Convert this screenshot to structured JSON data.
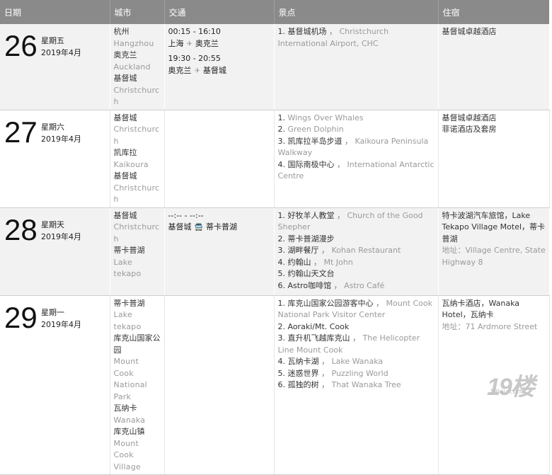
{
  "headers": {
    "date": "日期",
    "city": "城市",
    "transport": "交通",
    "sights": "景点",
    "hotel": "住宿"
  },
  "rows": [
    {
      "day": "26",
      "weekday": "星期五",
      "month": "2019年4月",
      "cities": [
        {
          "cn": "杭州",
          "en": "Hangzhou"
        },
        {
          "cn": "奥克兰",
          "en": "Auckland"
        },
        {
          "cn": "基督城",
          "en": "Christchurch"
        }
      ],
      "transport": [
        {
          "time": "00:15 - 16:10",
          "from": "上海",
          "to": "奥克兰",
          "mode": "✈"
        },
        {
          "time": "19:30 - 20:55",
          "from": "奥克兰",
          "to": "基督城",
          "mode": "✈"
        }
      ],
      "sights": [
        {
          "cn": "1. 基督城机场",
          "en": "Christchurch International Airport, CHC"
        }
      ],
      "hotel": {
        "lines": [
          "基督城卓越酒店"
        ],
        "addr": ""
      }
    },
    {
      "day": "27",
      "weekday": "星期六",
      "month": "2019年4月",
      "cities": [
        {
          "cn": "基督城",
          "en": "Christchurch"
        },
        {
          "cn": "凯库拉",
          "en": "Kaikoura"
        },
        {
          "cn": "基督城",
          "en": "Christchurch"
        }
      ],
      "transport": [],
      "sights": [
        {
          "cn": "1. ",
          "en": "Wings Over Whales"
        },
        {
          "cn": "2. ",
          "en": "Green Dolphin"
        },
        {
          "cn": "3. 凯库拉半岛步道",
          "en": "Kaikoura Peninsula Walkway"
        },
        {
          "cn": "4. 国际南极中心",
          "en": "International Antarctic Centre"
        }
      ],
      "hotel": {
        "lines": [
          "基督城卓越酒店",
          "菲诺酒店及套房"
        ],
        "addr": ""
      }
    },
    {
      "day": "28",
      "weekday": "星期天",
      "month": "2019年4月",
      "cities": [
        {
          "cn": "基督城",
          "en": "Christchurch"
        },
        {
          "cn": "蒂卡普湖",
          "en": "Lake tekapo"
        }
      ],
      "transport": [
        {
          "time": "--:-- - --:--",
          "from": "基督城",
          "to": "蒂卡普湖",
          "mode": "🚍"
        }
      ],
      "sights": [
        {
          "cn": "1. 好牧羊人教堂",
          "en": "Church of the Good Shepher"
        },
        {
          "cn": "2. 蒂卡普湖漫步",
          "en": ""
        },
        {
          "cn": "3. 湖畔餐厅",
          "en": "Kohan Restaurant"
        },
        {
          "cn": "4. 约翰山",
          "en": "Mt John"
        },
        {
          "cn": "5. 约翰山天文台",
          "en": ""
        },
        {
          "cn": "6. Astro咖啡馆",
          "en": "Astro Café"
        }
      ],
      "hotel": {
        "lines": [
          "特卡波湖汽车旅馆，Lake Tekapo Village Motel，蒂卡普湖"
        ],
        "addr": "地址：Village Centre, State Highway 8"
      }
    },
    {
      "day": "29",
      "weekday": "星期一",
      "month": "2019年4月",
      "cities": [
        {
          "cn": "蒂卡普湖",
          "en": "Lake tekapo"
        },
        {
          "cn": "库克山国家公园",
          "en": "Mount Cook National Park"
        },
        {
          "cn": "瓦纳卡",
          "en": "Wanaka"
        },
        {
          "cn": "库克山镇",
          "en": "Mount Cook Village"
        }
      ],
      "transport": [],
      "sights": [
        {
          "cn": "1. 库克山国家公园游客中心",
          "en": "Mount Cook National Park Visitor Center"
        },
        {
          "cn": "2. Aoraki/Mt. Cook",
          "en": ""
        },
        {
          "cn": "3. 直升机飞越库克山",
          "en": "The Helicopter Line Mount Cook"
        },
        {
          "cn": "4. 瓦纳卡湖",
          "en": "Lake Wanaka"
        },
        {
          "cn": "5. 迷惑世界",
          "en": "Puzzling World"
        },
        {
          "cn": "6. 孤独的树",
          "en": "That Wanaka Tree"
        }
      ],
      "hotel": {
        "lines": [
          "瓦纳卡酒店，Wanaka Hotel，瓦纳卡"
        ],
        "addr": "地址：71 Ardmore Street"
      }
    }
  ],
  "watermark": {
    "big": "19楼",
    "small": "19lou.com"
  }
}
